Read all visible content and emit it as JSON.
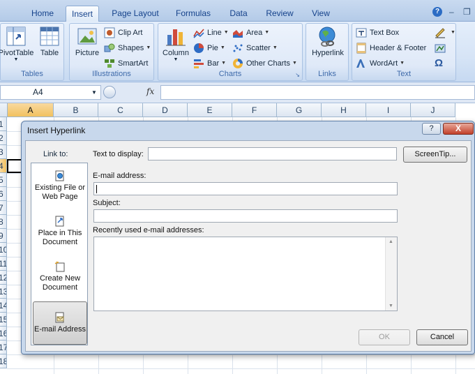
{
  "ribbon": {
    "tabs": [
      "Home",
      "Insert",
      "Page Layout",
      "Formulas",
      "Data",
      "Review",
      "View"
    ],
    "active_tab": "Insert",
    "groups": {
      "tables": {
        "title": "Tables",
        "pivot": "PivotTable",
        "table": "Table"
      },
      "illustrations": {
        "title": "Illustrations",
        "picture": "Picture",
        "clip_art": "Clip Art",
        "shapes": "Shapes",
        "smartart": "SmartArt"
      },
      "charts": {
        "title": "Charts",
        "column": "Column",
        "line": "Line",
        "pie": "Pie",
        "bar": "Bar",
        "area": "Area",
        "scatter": "Scatter",
        "other": "Other Charts"
      },
      "links": {
        "title": "Links",
        "hyperlink": "Hyperlink"
      },
      "text": {
        "title": "Text",
        "text_box": "Text Box",
        "header_footer": "Header & Footer",
        "wordart": "WordArt"
      }
    }
  },
  "formula_bar": {
    "name_box": "A4",
    "fx": "fx",
    "formula": ""
  },
  "sheet": {
    "columns": [
      "A",
      "B",
      "C",
      "D",
      "E",
      "F",
      "G",
      "H",
      "I",
      "J"
    ],
    "selected_column": "A",
    "rows": [
      "1",
      "2",
      "3",
      "4",
      "5",
      "6",
      "7",
      "8",
      "9",
      "10",
      "11",
      "12",
      "13",
      "14",
      "15",
      "16",
      "17",
      "18"
    ],
    "selected_row": "4"
  },
  "dialog": {
    "title": "Insert Hyperlink",
    "link_to_label": "Link to:",
    "link_to_items": [
      {
        "line1": "Existing File or",
        "line2": "Web Page"
      },
      {
        "line1": "Place in This",
        "line2": "Document"
      },
      {
        "line1": "Create New",
        "line2": "Document"
      },
      {
        "line1": "E-mail Address",
        "line2": ""
      }
    ],
    "selected_link_to": "E-mail Address",
    "text_to_display_label": "Text to display:",
    "text_to_display_value": "",
    "screentip_button": "ScreenTip...",
    "email_label": "E-mail address:",
    "email_value": "",
    "subject_label": "Subject:",
    "subject_value": "",
    "recent_label": "Recently used e-mail addresses:",
    "ok_button": "OK",
    "cancel_button": "Cancel",
    "help_button": "?",
    "close_button": "X"
  },
  "colors": {
    "ribbon_bg": "#dfe9f8",
    "accent": "#15428b",
    "selected_header": "#f1c15f",
    "close_red": "#c2402a"
  }
}
